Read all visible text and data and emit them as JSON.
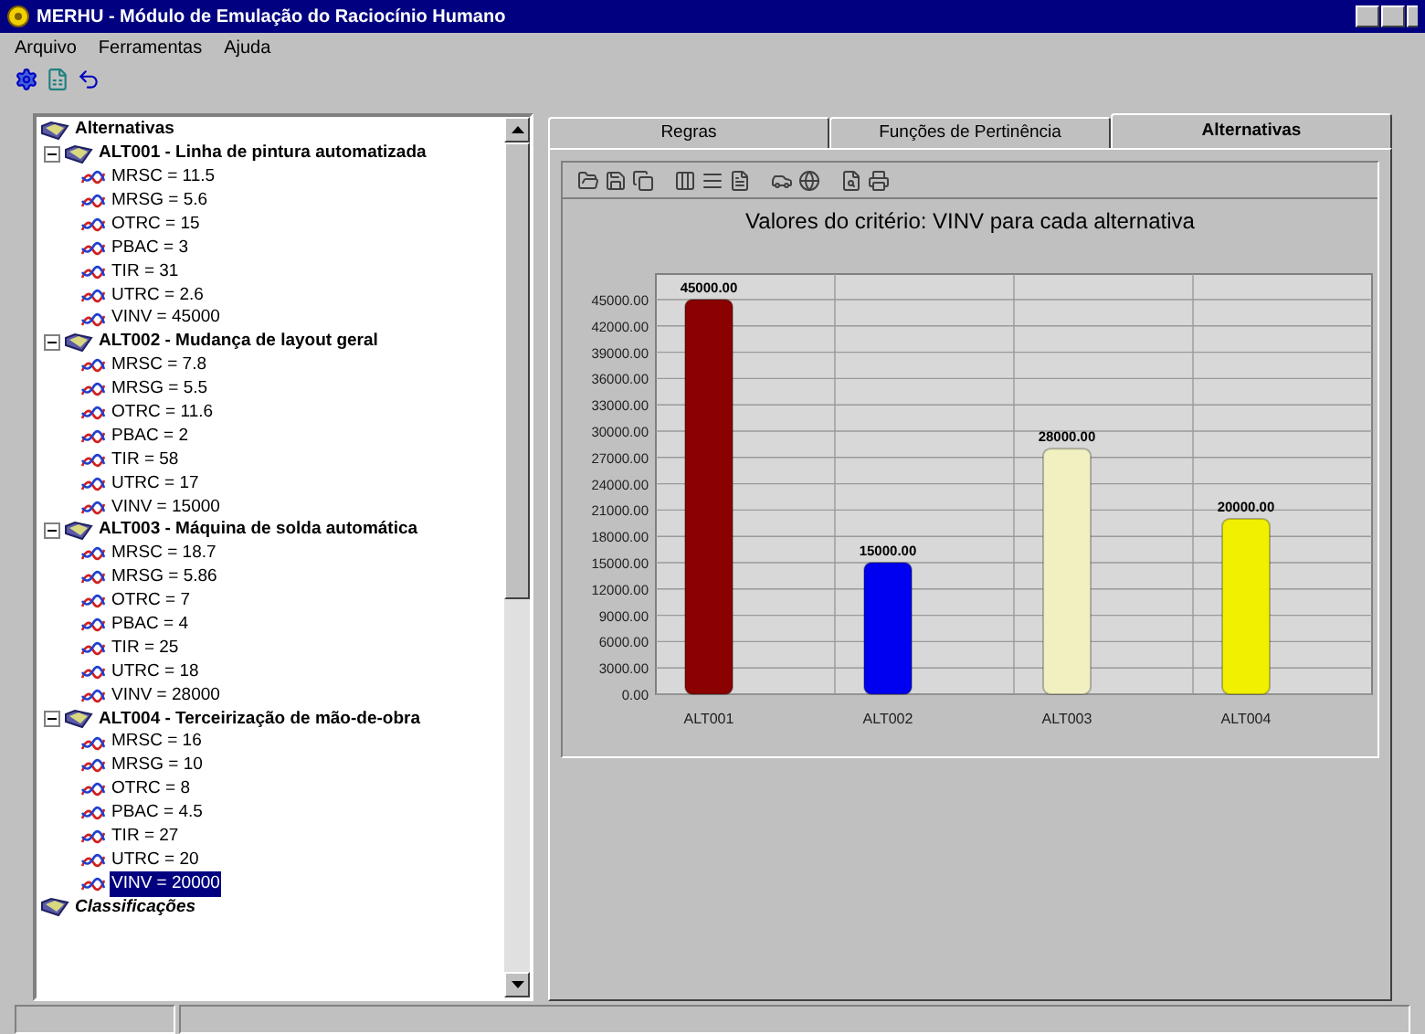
{
  "window": {
    "title": "MERHU - Módulo de Emulação do Raciocínio Humano"
  },
  "menu": [
    "Arquivo",
    "Ferramentas",
    "Ajuda"
  ],
  "tree": [
    {
      "label": "Alternativas",
      "expanded": true,
      "children": [
        {
          "label": "ALT001 - Linha de pintura automatizada",
          "expanded": true,
          "children": [
            {
              "label": "MRSC = 11.5",
              "selected": false
            },
            {
              "label": "MRSG = 5.6",
              "selected": false
            },
            {
              "label": "OTRC = 15",
              "selected": false
            },
            {
              "label": "PBAC = 3",
              "selected": false
            },
            {
              "label": "TIR = 31",
              "selected": false
            },
            {
              "label": "UTRC = 2.6",
              "selected": false
            },
            {
              "label": "VINV = 45000",
              "selected": false
            }
          ]
        },
        {
          "label": "ALT002 - Mudança de layout geral",
          "expanded": true,
          "children": [
            {
              "label": "MRSC = 7.8",
              "selected": false
            },
            {
              "label": "MRSG = 5.5",
              "selected": false
            },
            {
              "label": "OTRC = 11.6",
              "selected": false
            },
            {
              "label": "PBAC = 2",
              "selected": false
            },
            {
              "label": "TIR = 58",
              "selected": false
            },
            {
              "label": "UTRC = 17",
              "selected": false
            },
            {
              "label": "VINV = 15000",
              "selected": false
            }
          ]
        },
        {
          "label": "ALT003 - Máquina de solda automática",
          "expanded": true,
          "children": [
            {
              "label": "MRSC = 18.7",
              "selected": false
            },
            {
              "label": "MRSG = 5.86",
              "selected": false
            },
            {
              "label": "OTRC = 7",
              "selected": false
            },
            {
              "label": "PBAC = 4",
              "selected": false
            },
            {
              "label": "TIR = 25",
              "selected": false
            },
            {
              "label": "UTRC = 18",
              "selected": false
            },
            {
              "label": "VINV = 28000",
              "selected": false
            }
          ]
        },
        {
          "label": "ALT004 - Terceirização de mão-de-obra",
          "expanded": true,
          "children": [
            {
              "label": "MRSC = 16",
              "selected": false
            },
            {
              "label": "MRSG = 10",
              "selected": false
            },
            {
              "label": "OTRC = 8",
              "selected": false
            },
            {
              "label": "PBAC = 4.5",
              "selected": false
            },
            {
              "label": "TIR = 27",
              "selected": false
            },
            {
              "label": "UTRC = 20",
              "selected": false
            },
            {
              "label": "VINV = 20000",
              "selected": true
            }
          ]
        }
      ]
    },
    {
      "label": "Classificações",
      "expanded": false
    }
  ],
  "tabs": [
    {
      "label": "Regras",
      "selected": false
    },
    {
      "label": "Funções de Pertinência",
      "selected": false
    },
    {
      "label": "Alternativas",
      "selected": true
    }
  ],
  "chart_data": {
    "type": "bar",
    "title": "Valores do critério: VINV para cada alternativa",
    "categories": [
      "ALT001",
      "ALT002",
      "ALT003",
      "ALT004"
    ],
    "values": [
      45000,
      15000,
      28000,
      20000
    ],
    "grid": true,
    "colors": [
      "#8b0000",
      "#0000f0",
      "#f0f0c0",
      "#f0f000"
    ],
    "ylim": [
      0,
      45000
    ],
    "yticks": [
      {
        "value": 0,
        "label": "0.00"
      },
      {
        "value": 3000,
        "label": "3000.00"
      },
      {
        "value": 6000,
        "label": "6000.00"
      },
      {
        "value": 9000,
        "label": "9000.00"
      },
      {
        "value": 12000,
        "label": "12000.00"
      },
      {
        "value": 15000,
        "label": "15000.00"
      },
      {
        "value": 18000,
        "label": "18000.00"
      },
      {
        "value": 21000,
        "label": "21000.00"
      },
      {
        "value": 24000,
        "label": "24000.00"
      },
      {
        "value": 27000,
        "label": "27000.00"
      },
      {
        "value": 30000,
        "label": "30000.00"
      },
      {
        "value": 33000,
        "label": "33000.00"
      },
      {
        "value": 36000,
        "label": "36000.00"
      },
      {
        "value": 39000,
        "label": "39000.00"
      },
      {
        "value": 42000,
        "label": "42000.00"
      },
      {
        "value": 45000,
        "label": "45000.00"
      }
    ],
    "data_labels": true,
    "value_labels": [
      "45000.00",
      "15000.00",
      "28000.00",
      "20000.00"
    ]
  }
}
